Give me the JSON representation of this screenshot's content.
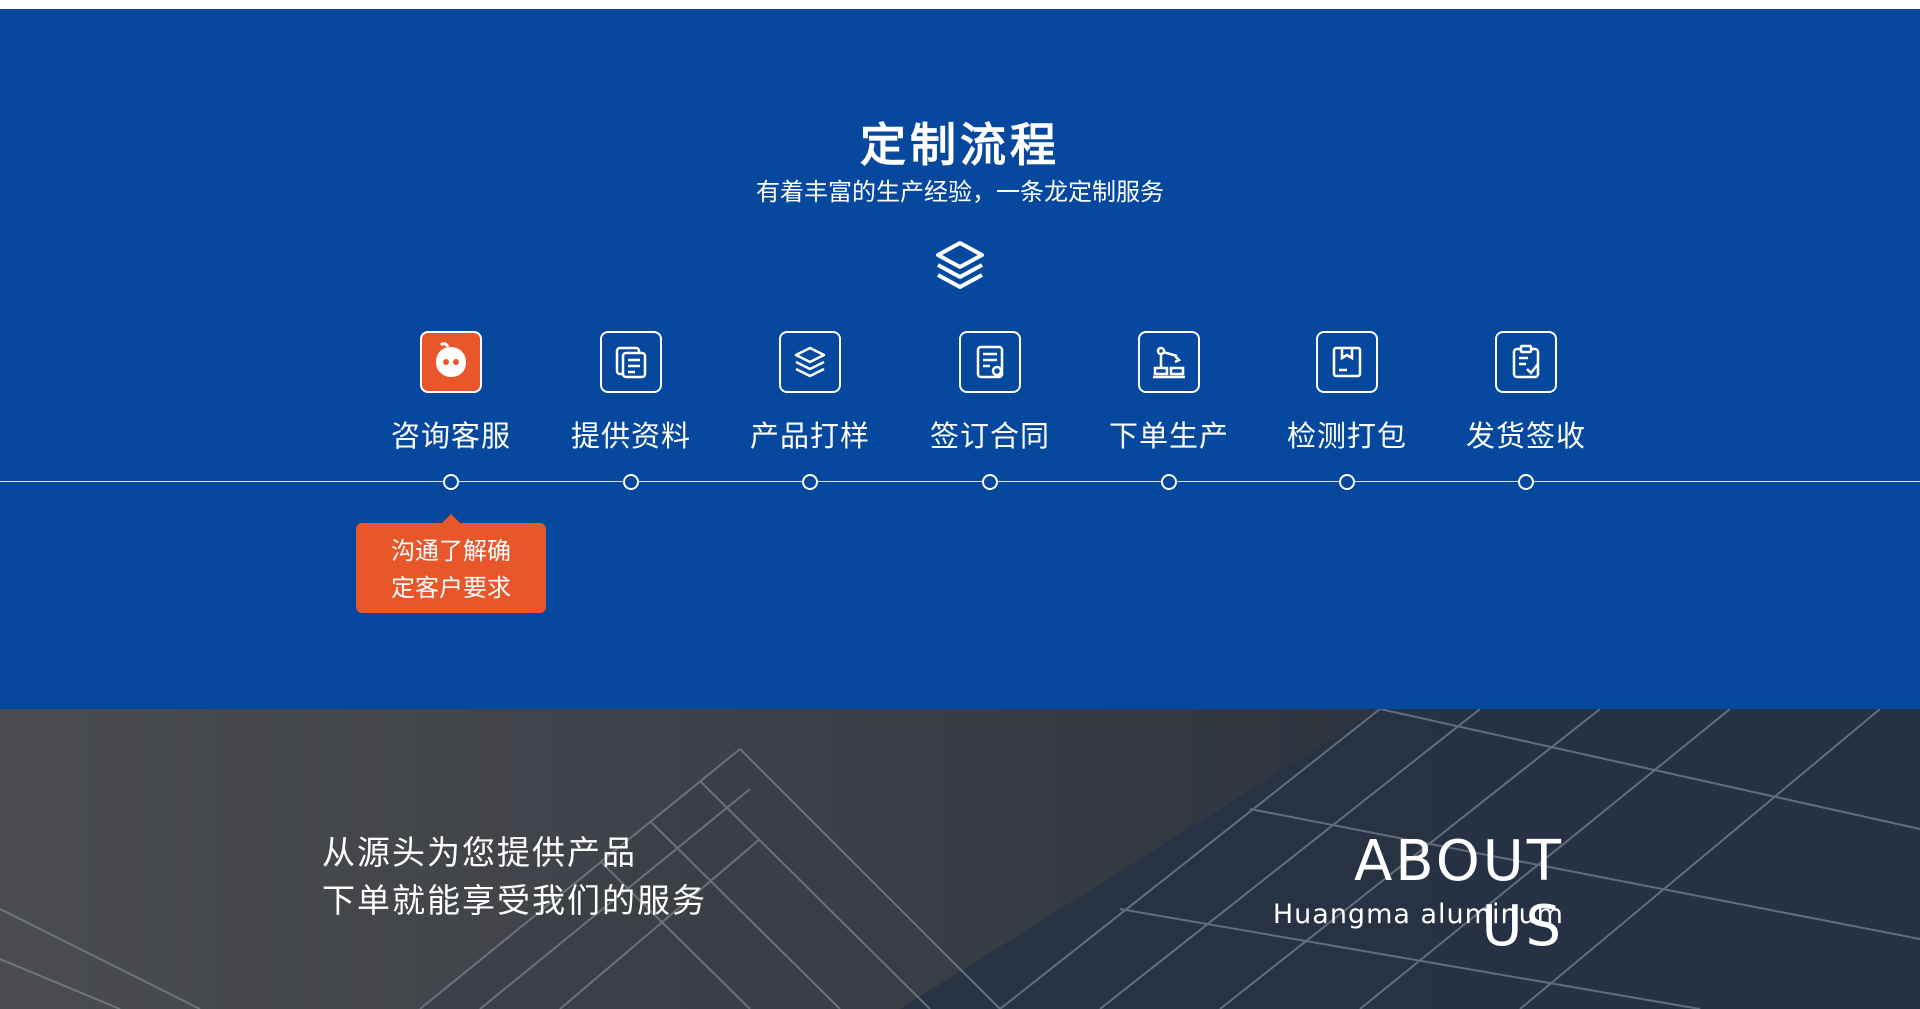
{
  "process": {
    "title": "定制流程",
    "subtitle": "有着丰富的生产经验，一条龙定制服务",
    "header_icon": "layers-icon",
    "accent_color": "#e8562a",
    "background_color": "#07489f",
    "steps": [
      {
        "label": "咨询客服",
        "icon": "chat-icon"
      },
      {
        "label": "提供资料",
        "icon": "documents-icon"
      },
      {
        "label": "产品打样",
        "icon": "layers-icon"
      },
      {
        "label": "签订合同",
        "icon": "contract-icon"
      },
      {
        "label": "下单生产",
        "icon": "robot-arm-icon"
      },
      {
        "label": "检测打包",
        "icon": "package-icon"
      },
      {
        "label": "发货签收",
        "icon": "clipboard-check-icon"
      }
    ],
    "active_tooltip": {
      "line1": "沟通了解确",
      "line2": "定客户要求"
    }
  },
  "about": {
    "slogan_line1": "从源头为您提供产品",
    "slogan_line2": "下单就能享受我们的服务",
    "title": "ABOUT US",
    "subtitle": "Huangma aluminum"
  }
}
